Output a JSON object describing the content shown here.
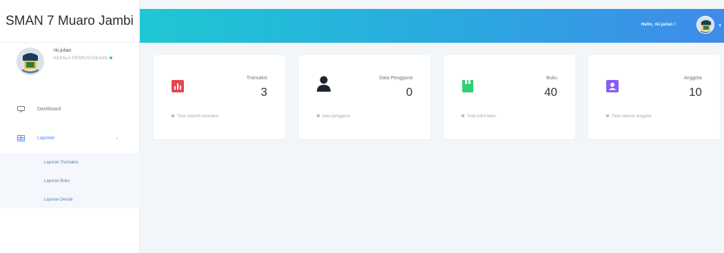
{
  "sidebar": {
    "brand": "SMAN 7 Muaro Jambi",
    "user": {
      "name": "rki.julian",
      "role": "KEPALA PERPUSTAKAAN"
    },
    "menu": {
      "dashboard_label": "Dashboard",
      "laporan_label": "Laporan",
      "sub_items": [
        "Laporan Transaksi",
        "Laporan Buku",
        "Laporan Denda"
      ]
    }
  },
  "topbar": {
    "greeting": "Hello, rki.julian !"
  },
  "cards": [
    {
      "title": "Transaksi",
      "value": "3",
      "footer": "Total seluruh transaksi",
      "icon": "chart-icon",
      "color": "#e5484d"
    },
    {
      "title": "Data Pengguna",
      "value": "0",
      "footer": "data pengguna",
      "icon": "user-icon",
      "color": "#1f2430"
    },
    {
      "title": "Buku",
      "value": "40",
      "footer": "Total judul buku",
      "icon": "book-icon",
      "color": "#2fcf76"
    },
    {
      "title": "Anggota",
      "value": "10",
      "footer": "Total seluruh anggota",
      "icon": "member-icon",
      "color": "#8b5cf6"
    }
  ],
  "colors": {
    "header_gradient_start": "#1fc7d4",
    "header_gradient_end": "#3f8bea",
    "accent": "#5a8dee"
  }
}
